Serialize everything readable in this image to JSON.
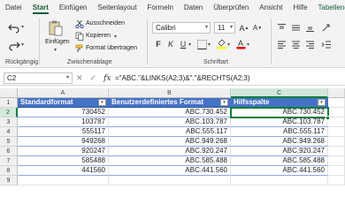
{
  "menu": {
    "tabs": [
      "Datei",
      "Start",
      "Einfügen",
      "Seitenlayout",
      "Formeln",
      "Daten",
      "Überprüfen",
      "Ansicht",
      "Hilfe",
      "Tabellenentw"
    ]
  },
  "ribbon": {
    "undo_group_label": "Rückgängig",
    "paste_label": "Einfügen",
    "cut_label": "Ausschneiden",
    "copy_label": "Kopieren",
    "format_painter_label": "Format übertragen",
    "clipboard_group_label": "Zwischenablage",
    "font_name": "Calibri",
    "font_size": "11",
    "font_group_label": "Schriftart",
    "bold": "F",
    "italic": "K",
    "underline": "U",
    "icons": [
      "undo-icon",
      "redo-icon",
      "clipboard-icon",
      "scissors-icon",
      "copy-icon",
      "paintbrush-icon",
      "font-grow-icon",
      "font-shrink-icon",
      "borders-icon",
      "fill-color-icon",
      "font-color-icon",
      "align-top-icon",
      "align-middle-icon",
      "align-bottom-icon",
      "align-left-icon",
      "align-center-icon",
      "align-right-icon"
    ]
  },
  "formula_bar": {
    "name_box": "C2",
    "cancel_glyph": "✕",
    "enter_glyph": "✓",
    "fx_label": "fx",
    "formula": "=\"ABC.\"&LINKS(A2;3)&\".\"&RECHTS(A2;3)"
  },
  "sheet": {
    "columns": [
      "A",
      "B",
      "C"
    ],
    "rows": [
      "1",
      "2",
      "3",
      "4",
      "5",
      "6",
      "7",
      "8",
      "9"
    ],
    "selected_cell": "C2",
    "table": {
      "headers": [
        "Standardformat",
        "Benutzerdefiniertes Format",
        "Hilfsspalte"
      ],
      "rows": [
        [
          "730452",
          "ABC.730.452",
          "ABC.730.452"
        ],
        [
          "103787",
          "ABC.103.787",
          "ABC.103.787"
        ],
        [
          "555117",
          "ABC.555.117",
          "ABC.555.117"
        ],
        [
          "949268",
          "ABC.949.268",
          "ABC.949.268"
        ],
        [
          "920247",
          "ABC.920.247",
          "ABC.920.247"
        ],
        [
          "585488",
          "ABC.585.488",
          "ABC.585.488"
        ],
        [
          "441560",
          "ABC.441.560",
          "ABC.441.560"
        ]
      ]
    },
    "filter_glyph": "▾"
  },
  "colors": {
    "accent": "#185c37",
    "table_header": "#4472c4",
    "selection": "#107c41"
  }
}
